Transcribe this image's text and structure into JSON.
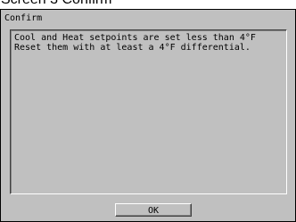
{
  "screen": {
    "title": "Screen 3 Confirm"
  },
  "dialog": {
    "title": "Confirm",
    "message_lines": [
      "Cool and Heat setpoints are set less than 4°F",
      "Reset them with at least a 4°F differential."
    ],
    "ok_label": "OK"
  },
  "colors": {
    "background": "#ffffff",
    "dialog_face": "#c0c0c0",
    "text": "#000000"
  }
}
